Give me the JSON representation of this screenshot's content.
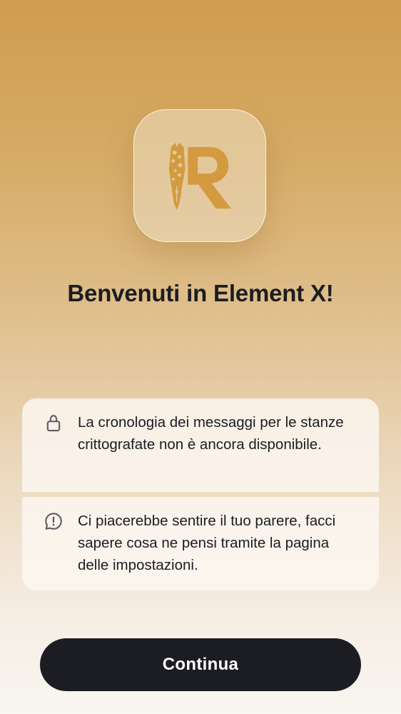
{
  "app": {
    "logo_icon": "app-logo-icon",
    "accent_color": "#d39a3f"
  },
  "welcome": {
    "title": "Benvenuti in Element X!"
  },
  "info_items": [
    {
      "icon": "lock-icon",
      "text": "La cronologia dei messaggi per le stanze crittografate non è ancora disponibile."
    },
    {
      "icon": "feedback-icon",
      "text": "Ci piacerebbe sentire il tuo parere, facci sapere cosa ne pensi tramite la pagina delle impostazioni."
    }
  ],
  "actions": {
    "continue_label": "Continua"
  },
  "colors": {
    "button_background": "#1b1d22",
    "button_text": "#ffffff",
    "title_text": "#1b1d22",
    "icon_gray": "#5a5d63"
  }
}
